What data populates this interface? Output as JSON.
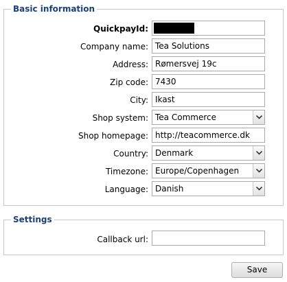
{
  "basic": {
    "legend": "Basic information",
    "fields": {
      "quickpay_id": {
        "label": "QuickpayId:",
        "value": ""
      },
      "company_name": {
        "label": "Company name:",
        "value": "Tea Solutions"
      },
      "address": {
        "label": "Address:",
        "value": "Rømersvej 19c"
      },
      "zip": {
        "label": "Zip code:",
        "value": "7430"
      },
      "city": {
        "label": "City:",
        "value": "Ikast"
      },
      "shop_system": {
        "label": "Shop system:",
        "value": "Tea Commerce"
      },
      "shop_homepage": {
        "label": "Shop homepage:",
        "value": "http://teacommerce.dk"
      },
      "country": {
        "label": "Country:",
        "value": "Denmark"
      },
      "timezone": {
        "label": "Timezone:",
        "value": "Europe/Copenhagen"
      },
      "language": {
        "label": "Language:",
        "value": "Danish"
      }
    }
  },
  "settings": {
    "legend": "Settings",
    "callback_label": "Callback url:",
    "callback_value": ""
  },
  "save_label": "Save",
  "colors": {
    "legend": "#1b3f7a",
    "border": "#c8c8c8"
  }
}
